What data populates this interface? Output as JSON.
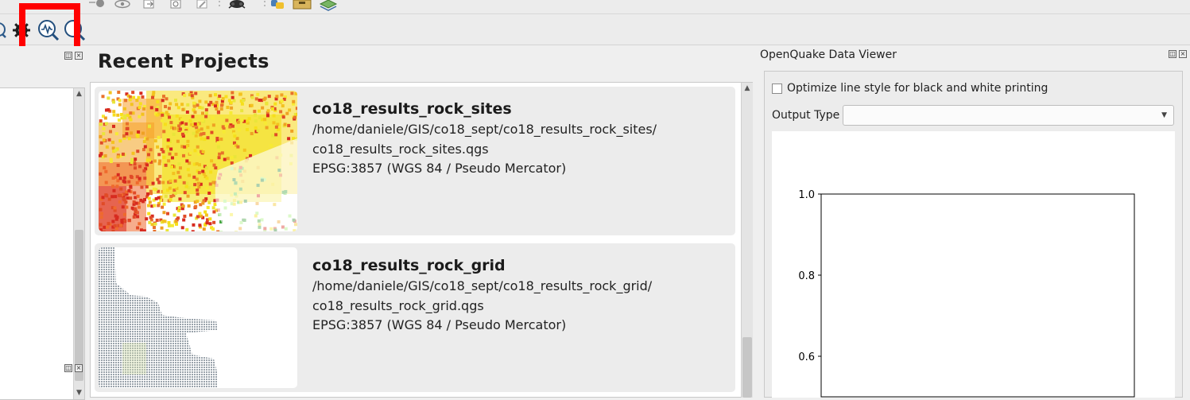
{
  "toolbar_top": {
    "icons": [
      "grey-tool-icon",
      "eye-icon",
      "export-icon",
      "refresh-icon",
      "edit-icon",
      "bug-icon",
      "python-icon",
      "folder-icon",
      "layers-icon"
    ]
  },
  "toolbar_oq": {
    "icons": [
      "partial-search-icon",
      "gear-icon",
      "hazard-curve-icon",
      "search-icon"
    ]
  },
  "recent_projects": {
    "title": "Recent Projects",
    "projects": [
      {
        "name": "co18_results_rock_sites",
        "path_line1": "/home/daniele/GIS/co18_sept/co18_results_rock_sites/",
        "path_line2": "co18_results_rock_sites.qgs",
        "crs": "EPSG:3857 (WGS 84 / Pseudo Mercator)"
      },
      {
        "name": "co18_results_rock_grid",
        "path_line1": "/home/daniele/GIS/co18_sept/co18_results_rock_grid/",
        "path_line2": "co18_results_rock_grid.qgs",
        "crs": "EPSG:3857 (WGS 84 / Pseudo Mercator)"
      }
    ]
  },
  "data_viewer": {
    "title": "OpenQuake Data Viewer",
    "bw_checkbox_label": "Optimize line style for black and white printing",
    "bw_checked": false,
    "output_type_label": "Output Type",
    "output_type_value": ""
  },
  "chart_data": {
    "type": "line",
    "series": [],
    "yticks": [
      "1.0",
      "0.8",
      "0.6"
    ],
    "ylim": [
      0.5,
      1.0
    ],
    "grid": false
  }
}
